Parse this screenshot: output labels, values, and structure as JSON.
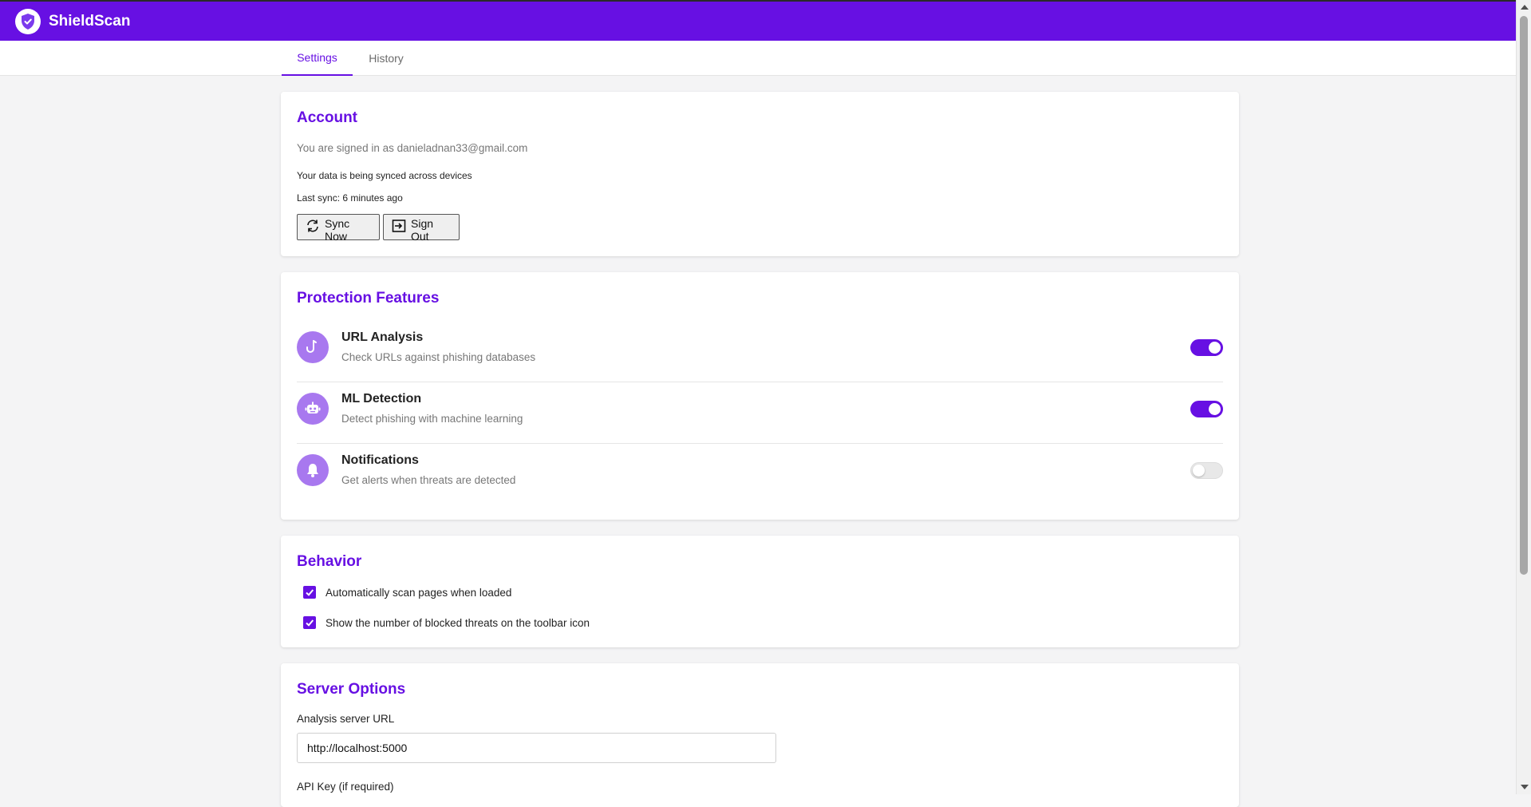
{
  "app": {
    "title": "ShieldScan",
    "brand_color": "#6710e3",
    "logo_icon": "shield-check-icon"
  },
  "tabs": [
    {
      "label": "Settings",
      "active": true
    },
    {
      "label": "History",
      "active": false
    }
  ],
  "account": {
    "title": "Account",
    "signed_in_text": "You are signed in as danieladnan33@gmail.com",
    "sync_status": "Your data is being synced across devices",
    "last_sync": "Last sync: 6 minutes ago",
    "sync_button": {
      "label": "Sync Now",
      "icon": "sync-icon"
    },
    "signout_button": {
      "label": "Sign Out",
      "icon": "sign-out-icon"
    }
  },
  "protection": {
    "title": "Protection Features",
    "features": [
      {
        "name": "URL Analysis",
        "description": "Check URLs against phishing databases",
        "icon": "hook-icon",
        "enabled": true
      },
      {
        "name": "ML Detection",
        "description": "Detect phishing with machine learning",
        "icon": "robot-icon",
        "enabled": true
      },
      {
        "name": "Notifications",
        "description": "Get alerts when threats are detected",
        "icon": "bell-icon",
        "enabled": false
      }
    ]
  },
  "behavior": {
    "title": "Behavior",
    "options": [
      {
        "label": "Automatically scan pages when loaded",
        "checked": true
      },
      {
        "label": "Show the number of blocked threats on the toolbar icon",
        "checked": true
      }
    ]
  },
  "server": {
    "title": "Server Options",
    "url_label": "Analysis server URL",
    "url_value": "http://localhost:5000",
    "api_key_label": "API Key (if required)"
  }
}
